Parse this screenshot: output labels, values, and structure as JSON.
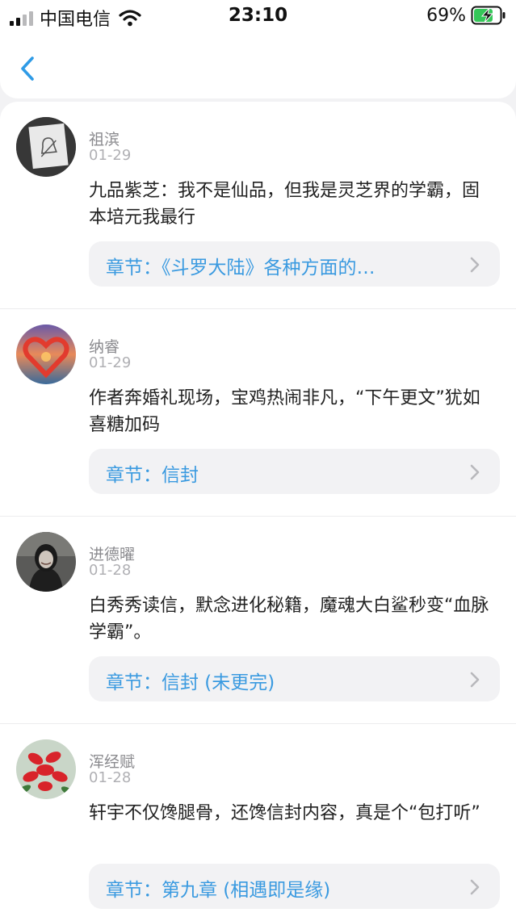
{
  "status_bar": {
    "carrier": "中国电信",
    "time": "23:10",
    "battery": "69%"
  },
  "nav": {
    "back_icon": "chevron-left-icon",
    "accent": "#2f9be6"
  },
  "colors": {
    "chapter_text": "#3a9ae0",
    "chapter_bg": "#f2f2f4"
  },
  "comments": [
    {
      "user": "祖滨",
      "date": "01-29",
      "text": "九品紫芝：我不是仙品，但我是灵芝界的学霸，固本培元我最行",
      "chapter": "章节：《斗罗大陆》各种方面的…"
    },
    {
      "user": "纳睿",
      "date": "01-29",
      "text": "作者奔婚礼现场，宝鸡热闹非凡，“下午更文”犹如喜糖加码",
      "chapter": "章节：信封"
    },
    {
      "user": "进德曜",
      "date": "01-28",
      "text": "白秀秀读信，默念进化秘籍，魔魂大白鲨秒变“血脉学霸”。",
      "chapter": "章节：信封 (未更完)"
    },
    {
      "user": "浑经赋",
      "date": "01-28",
      "text": "轩宇不仅馋腿骨，还馋信封内容，真是个“包打听”",
      "chapter": "章节：第九章 (相遇即是缘)"
    }
  ]
}
